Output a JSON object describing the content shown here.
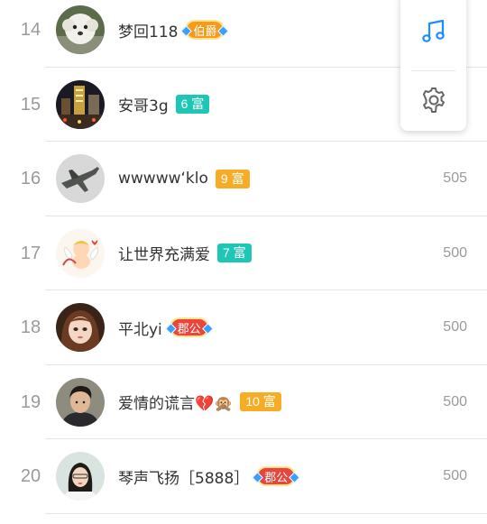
{
  "colors": {
    "rich_teal": "#1ec6b6",
    "rich_orange": "#f6ad25",
    "title_orange": "#f59b1b",
    "title_red": "#e8453c",
    "music_blue": "#1a8cff",
    "gear_gray": "#666666"
  },
  "rows": [
    {
      "rank": "14",
      "name": "梦回118",
      "badge": {
        "kind": "title",
        "text": "伯爵",
        "color": "#f59b1b"
      },
      "score": "",
      "avatar": "white-dog"
    },
    {
      "rank": "15",
      "name": "安哥3g",
      "badge": {
        "kind": "rich",
        "text": "6 富",
        "color": "#1ec6b6"
      },
      "score": "",
      "avatar": "city-night"
    },
    {
      "rank": "16",
      "name": "wwwww‘klo",
      "badge": {
        "kind": "rich",
        "text": "9 富",
        "color": "#f6ad25"
      },
      "score": "505",
      "avatar": "airplane"
    },
    {
      "rank": "17",
      "name": "让世界充满爱",
      "badge": {
        "kind": "rich",
        "text": "7 富",
        "color": "#1ec6b6"
      },
      "score": "500",
      "avatar": "cupid"
    },
    {
      "rank": "18",
      "name": "平北yi",
      "badge": {
        "kind": "title",
        "text": "郡公",
        "color": "#e8453c"
      },
      "score": "500",
      "avatar": "doll"
    },
    {
      "rank": "19",
      "name": "爱情的谎言💔🙊",
      "badge": {
        "kind": "rich",
        "text": "10 富",
        "color": "#f6ad25"
      },
      "score": "500",
      "avatar": "man"
    },
    {
      "rank": "20",
      "name": "琴声飞扬［5888］",
      "badge": {
        "kind": "title",
        "text": "郡公",
        "color": "#e8453c"
      },
      "score": "500",
      "avatar": "woman"
    }
  ],
  "float_panel": {
    "buttons": [
      {
        "icon": "music-note-icon"
      },
      {
        "icon": "gear-icon"
      }
    ]
  }
}
